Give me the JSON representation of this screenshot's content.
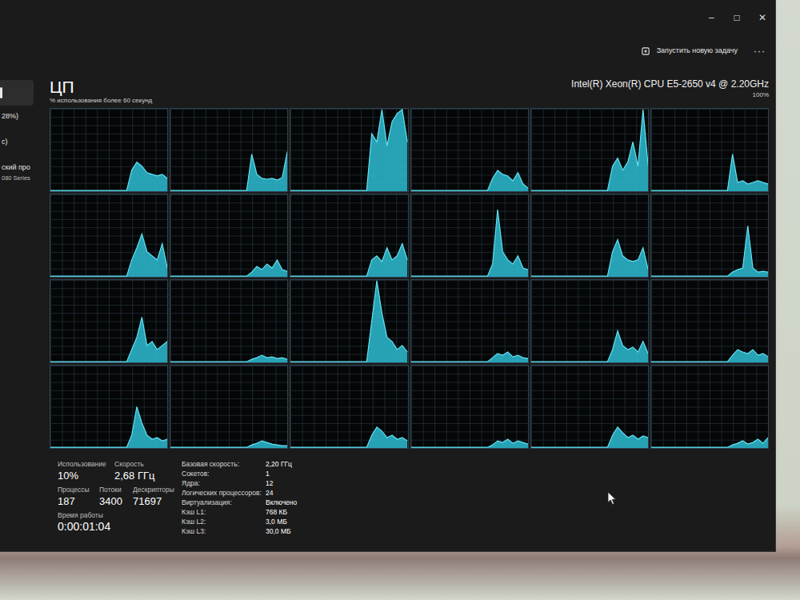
{
  "window": {
    "controls": [
      "–",
      "□",
      "✕"
    ]
  },
  "toolbar": {
    "run_task": "Запустить новую задачу",
    "more": "···"
  },
  "sidebar": {
    "items": [
      {
        "selected": true
      },
      {
        "label": "28%)",
        "selected": false
      },
      {
        "label": "с)",
        "selected": false
      },
      {
        "label": "ский про",
        "sub": "080 Series",
        "selected": false
      }
    ]
  },
  "header": {
    "title": "ЦП",
    "subtitle": "% использования более 60 секунд",
    "cpu_name": "Intel(R) Xeon(R) CPU E5-2650 v4 @ 2.20GHz",
    "max_label": "100%"
  },
  "chart": {
    "cores": [
      {
        "values": [
          0,
          0,
          0,
          0,
          0,
          0,
          0,
          0,
          0,
          0,
          0,
          0,
          0,
          0,
          0,
          0,
          25,
          35,
          30,
          22,
          20,
          18,
          20,
          15
        ]
      },
      {
        "values": [
          0,
          0,
          0,
          0,
          0,
          0,
          0,
          0,
          0,
          0,
          0,
          0,
          0,
          0,
          0,
          0,
          45,
          20,
          15,
          14,
          15,
          13,
          16,
          48
        ]
      },
      {
        "values": [
          0,
          0,
          0,
          0,
          0,
          0,
          0,
          0,
          0,
          0,
          0,
          0,
          0,
          0,
          0,
          0,
          70,
          60,
          100,
          55,
          85,
          95,
          100,
          60
        ]
      },
      {
        "values": [
          0,
          0,
          0,
          0,
          0,
          0,
          0,
          0,
          0,
          0,
          0,
          0,
          0,
          0,
          0,
          0,
          15,
          25,
          20,
          18,
          12,
          22,
          8,
          3
        ]
      },
      {
        "values": [
          0,
          0,
          0,
          0,
          0,
          0,
          0,
          0,
          0,
          0,
          0,
          0,
          0,
          0,
          0,
          0,
          30,
          40,
          25,
          35,
          60,
          30,
          100,
          30
        ]
      },
      {
        "values": [
          0,
          0,
          0,
          0,
          0,
          0,
          0,
          0,
          0,
          0,
          0,
          0,
          0,
          0,
          0,
          0,
          45,
          10,
          12,
          8,
          10,
          12,
          10,
          8
        ]
      },
      {
        "values": [
          0,
          0,
          0,
          0,
          0,
          0,
          0,
          0,
          0,
          0,
          0,
          0,
          0,
          0,
          0,
          0,
          20,
          35,
          52,
          30,
          25,
          20,
          40,
          10
        ]
      },
      {
        "values": [
          0,
          0,
          0,
          0,
          0,
          0,
          0,
          0,
          0,
          0,
          0,
          0,
          0,
          0,
          0,
          0,
          5,
          12,
          8,
          15,
          10,
          20,
          8,
          6
        ]
      },
      {
        "values": [
          0,
          0,
          0,
          0,
          0,
          0,
          0,
          0,
          0,
          0,
          0,
          0,
          0,
          0,
          0,
          0,
          20,
          25,
          18,
          35,
          20,
          25,
          40,
          20
        ]
      },
      {
        "values": [
          0,
          0,
          0,
          0,
          0,
          0,
          0,
          0,
          0,
          0,
          0,
          0,
          0,
          0,
          0,
          0,
          15,
          82,
          30,
          20,
          15,
          25,
          10,
          8
        ]
      },
      {
        "values": [
          0,
          0,
          0,
          0,
          0,
          0,
          0,
          0,
          0,
          0,
          0,
          0,
          0,
          0,
          0,
          0,
          30,
          45,
          25,
          20,
          18,
          20,
          35,
          8
        ]
      },
      {
        "values": [
          0,
          0,
          0,
          0,
          0,
          0,
          0,
          0,
          0,
          0,
          0,
          0,
          0,
          0,
          0,
          0,
          5,
          8,
          10,
          62,
          10,
          5,
          6,
          5
        ]
      },
      {
        "values": [
          0,
          0,
          0,
          0,
          0,
          0,
          0,
          0,
          0,
          0,
          0,
          0,
          0,
          0,
          0,
          0,
          15,
          30,
          55,
          20,
          25,
          15,
          20,
          25
        ]
      },
      {
        "values": [
          0,
          0,
          0,
          0,
          0,
          0,
          0,
          0,
          0,
          0,
          0,
          0,
          0,
          0,
          0,
          0,
          3,
          5,
          8,
          5,
          6,
          4,
          5,
          3
        ]
      },
      {
        "values": [
          0,
          0,
          0,
          0,
          0,
          0,
          0,
          0,
          0,
          0,
          0,
          0,
          0,
          0,
          0,
          0,
          50,
          100,
          60,
          30,
          25,
          15,
          20,
          12
        ]
      },
      {
        "values": [
          0,
          0,
          0,
          0,
          0,
          0,
          0,
          0,
          0,
          0,
          0,
          0,
          0,
          0,
          0,
          0,
          5,
          10,
          8,
          12,
          6,
          8,
          5,
          4
        ]
      },
      {
        "values": [
          0,
          0,
          0,
          0,
          0,
          0,
          0,
          0,
          0,
          0,
          0,
          0,
          0,
          0,
          0,
          0,
          15,
          38,
          20,
          15,
          18,
          12,
          25,
          10
        ]
      },
      {
        "values": [
          0,
          0,
          0,
          0,
          0,
          0,
          0,
          0,
          0,
          0,
          0,
          0,
          0,
          0,
          0,
          0,
          8,
          15,
          12,
          10,
          15,
          8,
          10,
          6
        ]
      },
      {
        "values": [
          0,
          0,
          0,
          0,
          0,
          0,
          0,
          0,
          0,
          0,
          0,
          0,
          0,
          0,
          0,
          0,
          15,
          50,
          30,
          15,
          10,
          12,
          8,
          10
        ]
      },
      {
        "values": [
          0,
          0,
          0,
          0,
          0,
          0,
          0,
          0,
          0,
          0,
          0,
          0,
          0,
          0,
          0,
          0,
          3,
          5,
          8,
          6,
          4,
          3,
          2,
          2
        ]
      },
      {
        "values": [
          0,
          0,
          0,
          0,
          0,
          0,
          0,
          0,
          0,
          0,
          0,
          0,
          0,
          0,
          0,
          0,
          15,
          25,
          20,
          12,
          15,
          10,
          12,
          8
        ]
      },
      {
        "values": [
          0,
          0,
          0,
          0,
          0,
          0,
          0,
          0,
          0,
          0,
          0,
          0,
          0,
          0,
          0,
          0,
          3,
          8,
          6,
          10,
          5,
          8,
          6,
          4
        ]
      },
      {
        "values": [
          0,
          0,
          0,
          0,
          0,
          0,
          0,
          0,
          0,
          0,
          0,
          0,
          0,
          0,
          0,
          0,
          15,
          25,
          18,
          12,
          15,
          10,
          14,
          12
        ]
      },
      {
        "values": [
          0,
          0,
          0,
          0,
          0,
          0,
          0,
          0,
          0,
          0,
          0,
          0,
          0,
          0,
          0,
          0,
          3,
          5,
          8,
          4,
          6,
          10,
          5,
          12
        ]
      }
    ]
  },
  "stats": {
    "primary": [
      {
        "label": "Использование",
        "value": "10%"
      },
      {
        "label": "Скорость",
        "value": "2,68 ГГц"
      }
    ],
    "secondary": [
      {
        "label": "Процессы",
        "value": "187"
      },
      {
        "label": "Потоки",
        "value": "3400"
      },
      {
        "label": "Дескрипторы",
        "value": "71697"
      }
    ],
    "uptime": {
      "label": "Время работы",
      "value": "0:00:01:04"
    }
  },
  "details": [
    {
      "label": "Базовая скорость:",
      "value": "2,20 ГГц"
    },
    {
      "label": "Сокетов:",
      "value": "1"
    },
    {
      "label": "Ядра:",
      "value": "12"
    },
    {
      "label": "Логических процессоров:",
      "value": "24"
    },
    {
      "label": "Виртуализация:",
      "value": "Включено"
    },
    {
      "label": "Кэш L1:",
      "value": "768 КБ"
    },
    {
      "label": "Кэш L2:",
      "value": "3,0 МБ"
    },
    {
      "label": "Кэш L3:",
      "value": "30,0 МБ"
    }
  ]
}
